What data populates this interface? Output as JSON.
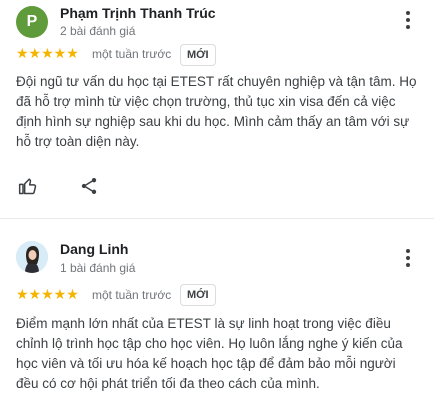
{
  "reviews": [
    {
      "avatar_letter": "P",
      "avatar_color": "#5f9b3a",
      "name": "Phạm Trịnh Thanh Trúc",
      "review_count": "2 bài đánh giá",
      "stars": "★★★★★",
      "rating": 5,
      "time": "một tuần trước",
      "badge": "MỚI",
      "text": "Đội ngũ tư vấn du học tại ETEST rất chuyên nghiệp và tận tâm. Họ đã hỗ trợ mình từ việc chọn trường, thủ tục xin visa đến cả việc định hình sự nghiệp sau khi du học. Mình cảm thấy an tâm với sự hỗ trợ toàn diện này.",
      "actions": {
        "like_icon": "thumbs-up-icon",
        "share_icon": "share-icon"
      }
    },
    {
      "avatar_icon": "profile-photo",
      "name": "Dang Linh",
      "review_count": "1 bài đánh giá",
      "stars": "★★★★★",
      "rating": 5,
      "time": "một tuần trước",
      "badge": "MỚI",
      "text": "Điểm mạnh lớn nhất của ETEST là sự linh hoạt trong việc điều chỉnh lộ trình học tập cho học viên. Họ luôn lắng nghe ý kiến của học viên và tối ưu hóa kế hoạch học tập để đảm bảo mỗi người đều có cơ hội phát triển tối đa theo cách của mình."
    }
  ],
  "colors": {
    "star": "#f4b400",
    "text": "#3c4043",
    "muted": "#70757a"
  }
}
